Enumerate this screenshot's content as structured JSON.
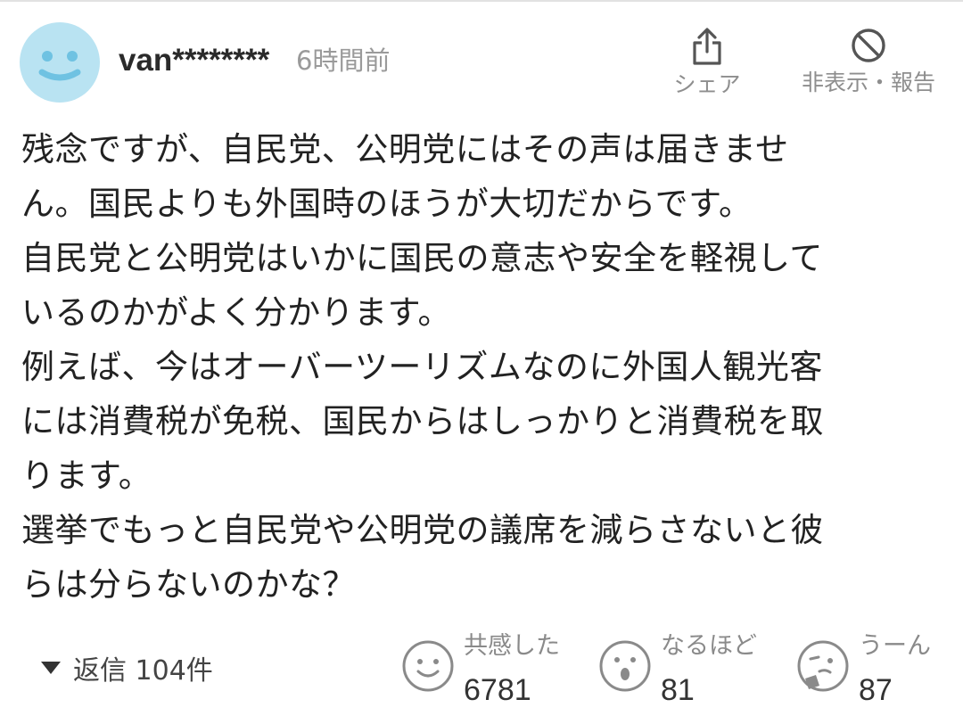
{
  "header": {
    "username": "van********",
    "timestamp": "6時間前",
    "actions": {
      "share_label": "シェア",
      "hide_report_label": "非表示・報告"
    }
  },
  "comment": {
    "lines": [
      "残念ですが、自民党、公明党にはその声は届きませ",
      "ん。国民よりも外国時のほうが大切だからです。",
      "自民党と公明党はいかに国民の意志や安全を軽視して",
      "いるのかがよく分かります。",
      "例えば、今はオーバーツーリズムなのに外国人観光客",
      "には消費税が免税、国民からはしっかりと消費税を取",
      "ります。",
      "選挙でもっと自民党や公明党の議席を減らさないと彼",
      "らは分らないのかな？"
    ]
  },
  "footer": {
    "replies_label": "返信 104件",
    "reactions": [
      {
        "label": "共感した",
        "count": "6781",
        "icon": "smile-icon"
      },
      {
        "label": "なるほど",
        "count": "81",
        "icon": "surprised-icon"
      },
      {
        "label": "うーん",
        "count": "87",
        "icon": "puzzled-icon"
      }
    ]
  },
  "colors": {
    "avatar_bg": "#b9e3f2",
    "avatar_face": "#6fc2e2",
    "muted_text": "#8e8e8e",
    "body_text": "#222222"
  }
}
